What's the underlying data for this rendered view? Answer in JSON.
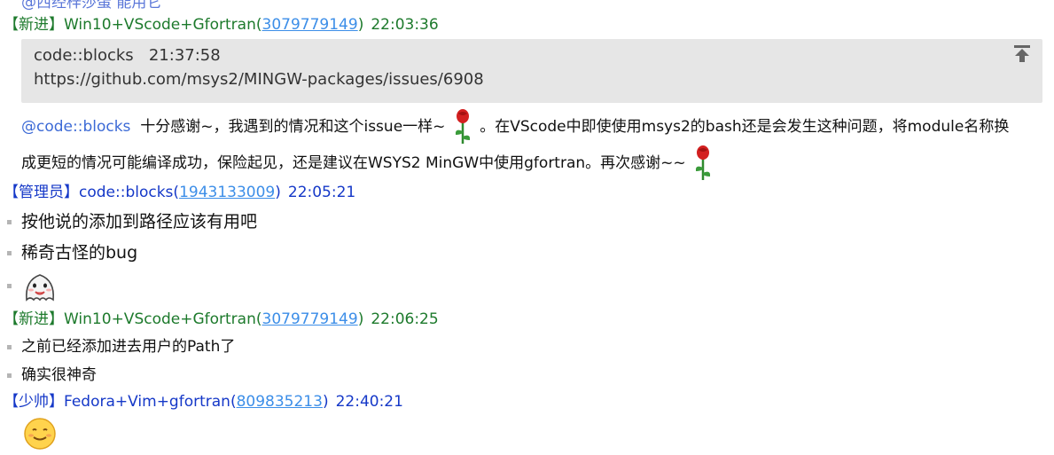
{
  "top_fragment": "@西经梓莎蛋 能用它",
  "messages": [
    {
      "role": "【新进】",
      "name": "Win10+VScode+Gfortran",
      "qq": "3079779149",
      "time": "22:03:36",
      "quote": {
        "author": "code::blocks",
        "time": "21:37:58",
        "text": "https://github.com/msys2/MINGW-packages/issues/6908"
      },
      "reply": {
        "mention": "@code::blocks",
        "part1": "十分感谢~，我遇到的情况和这个issue一样~",
        "part2": "。在VScode中即使使用msys2的bash还是会发生这种问题，将module名称换",
        "part3": "成更短的情况可能编译成功，保险起见，还是建议在WSYS2 MinGW中使用gfortran。再次感谢~~"
      }
    },
    {
      "role": "【管理员】",
      "name": "code::blocks",
      "qq": "1943133009",
      "time": "22:05:21",
      "lines": [
        "按他说的添加到路径应该有用吧",
        "稀奇古怪的bug"
      ]
    },
    {
      "role": "【新进】",
      "name": "Win10+VScode+Gfortran",
      "qq": "3079779149",
      "time": "22:06:25",
      "lines": [
        "之前已经添加进去用户的Path了",
        "确实很神奇"
      ]
    },
    {
      "role": "【少帅】",
      "name": "Fedora+Vim+gfortran",
      "qq": "809835213",
      "time": "22:40:21"
    }
  ],
  "colors": {
    "new_member": "#1d7a2c",
    "admin": "#1538c8",
    "qq_link": "#3c8ee8",
    "quote_bg": "#e6e6e6"
  },
  "icons": [
    "pin-top-icon",
    "rose-emoji",
    "ghost-sticker",
    "smile-emoji"
  ]
}
